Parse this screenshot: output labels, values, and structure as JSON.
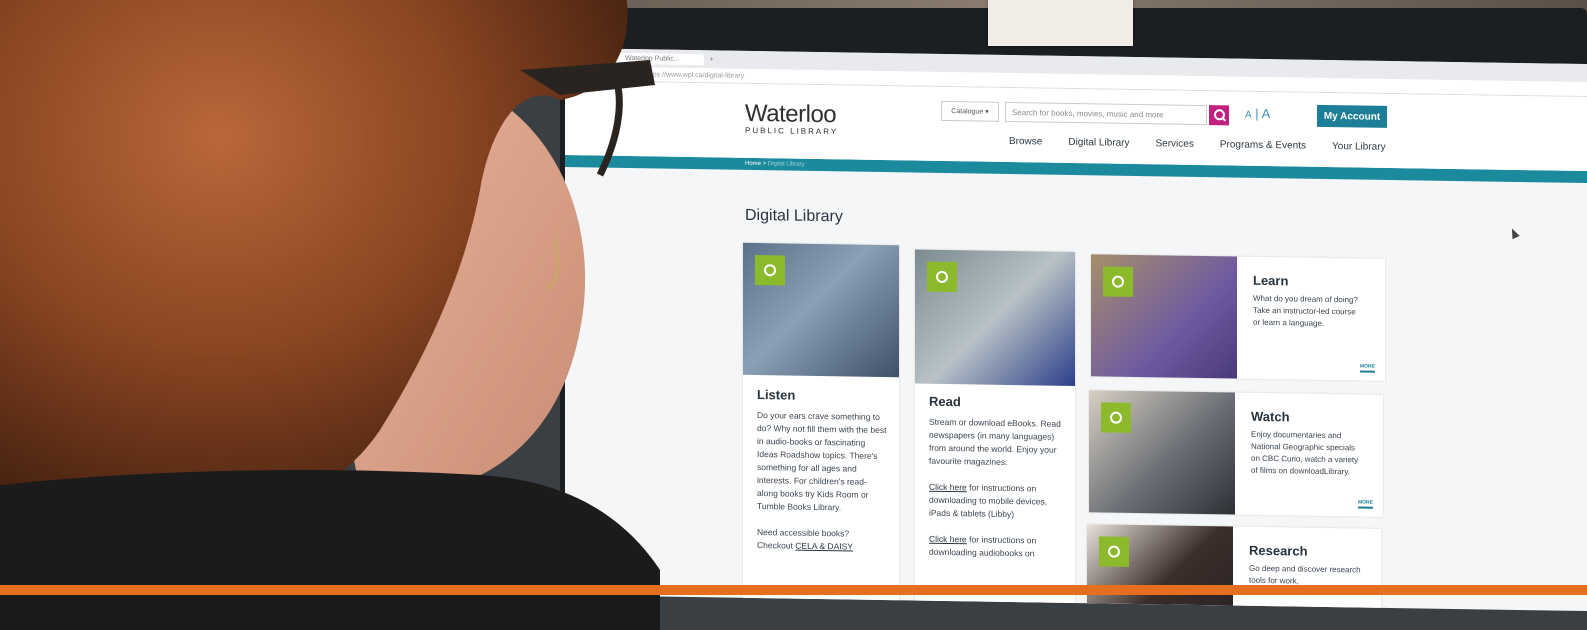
{
  "browser": {
    "tab_title": "Waterloo Public...",
    "url": "https://www.wpl.ca/digital-library"
  },
  "site": {
    "logo_main": "Waterloo",
    "logo_sub": "PUBLIC LIBRARY",
    "search": {
      "scope": "Catalogue",
      "placeholder": "Search for books, movies, music and more"
    },
    "font_small": "A",
    "font_large": "A",
    "account_button": "My Account",
    "nav": [
      "Browse",
      "Digital Library",
      "Services",
      "Programs & Events",
      "Your Library"
    ],
    "breadcrumb": [
      "Home",
      "Digital Library"
    ],
    "page_title": "Digital Library"
  },
  "cards": {
    "listen": {
      "title": "Listen",
      "body": "Do your ears crave something to do? Why not fill them with the best in audio-books or fascinating Ideas Roadshow topics. There's something for all ages and interests. For children's read-along books try Kids Room or Tumble Books Library.",
      "note": "Need accessible books? Checkout",
      "link": "CELA & DAISY",
      "icon": "headphones-icon"
    },
    "read": {
      "title": "Read",
      "body": "Stream or download eBooks. Read newspapers (in many languages) from around the world. Enjoy your favourite magazines.",
      "link1": "Click here",
      "link1_text": "for instructions on downloading to mobile devices, iPads & tablets (Libby)",
      "link2": "Click here",
      "link2_text": "for instructions on downloading audiobooks on",
      "icon": "book-icon"
    },
    "learn": {
      "title": "Learn",
      "body": "What do you dream of doing? Take an instructor-led course or learn a language.",
      "more": "MORE",
      "icon": "lightbulb-icon"
    },
    "watch": {
      "title": "Watch",
      "body": "Enjoy documentaries and National Geographic specials on CBC Curio, watch a variety of films on downloadLibrary.",
      "more": "MORE",
      "icon": "play-icon"
    },
    "research": {
      "title": "Research",
      "body": "Go deep and discover research tools for work,",
      "icon": "chart-icon"
    }
  },
  "colors": {
    "accent_teal": "#1b8a9d",
    "search_magenta": "#c2207f",
    "icon_green": "#8cba2c"
  }
}
